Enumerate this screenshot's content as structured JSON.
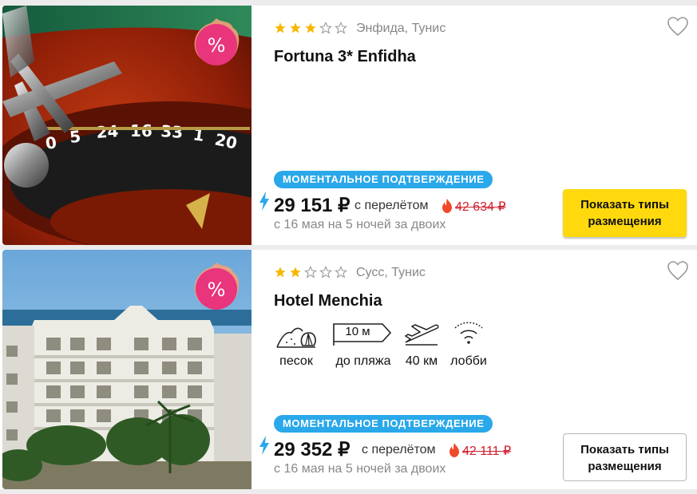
{
  "hotels": [
    {
      "stars": 3,
      "max_stars": 5,
      "location": "Энфида, Тунис",
      "name": "Fortuna 3* Enfidha",
      "image": "casino-roulette-photo",
      "discount_badge": "%",
      "instant_label": "МОМЕНТАЛЬНОЕ ПОДТВЕРЖДЕНИЕ",
      "price": "29 151 ₽",
      "price_note": "с перелётом",
      "old_price": "42 634 ₽",
      "dates": "с 16 мая на 5 ночей за двоих",
      "button_line1": "Показать типы",
      "button_line2": "размещения",
      "button_style": "yellow",
      "amenities": []
    },
    {
      "stars": 2,
      "max_stars": 5,
      "location": "Сусс, Тунис",
      "name": "Hotel Menchia",
      "image": "white-hotel-building-photo",
      "discount_badge": "%",
      "instant_label": "МОМЕНТАЛЬНОЕ ПОДТВЕРЖДЕНИЕ",
      "price": "29 352 ₽",
      "price_note": "с перелётом",
      "old_price": "42 111 ₽",
      "dates": "с 16 мая на 5 ночей за двоих",
      "button_line1": "Показать типы",
      "button_line2": "размещения",
      "button_style": "white",
      "amenities": [
        {
          "icon": "sand-beach-icon",
          "label": "песок"
        },
        {
          "icon": "beach-distance-sign-icon",
          "sign_text": "10 м",
          "label": "до пляжа"
        },
        {
          "icon": "airplane-icon",
          "label": "40 км"
        },
        {
          "icon": "wifi-icon",
          "label": "лобби"
        }
      ]
    }
  ],
  "colors": {
    "star": "#f6b800",
    "instant_badge": "#2aa8ea",
    "discount_badge": "#e8357c",
    "old_price": "#d0202f",
    "button_primary": "#ffd90d",
    "bolt": "#2aa8ea",
    "fire": "#f04a2a"
  }
}
